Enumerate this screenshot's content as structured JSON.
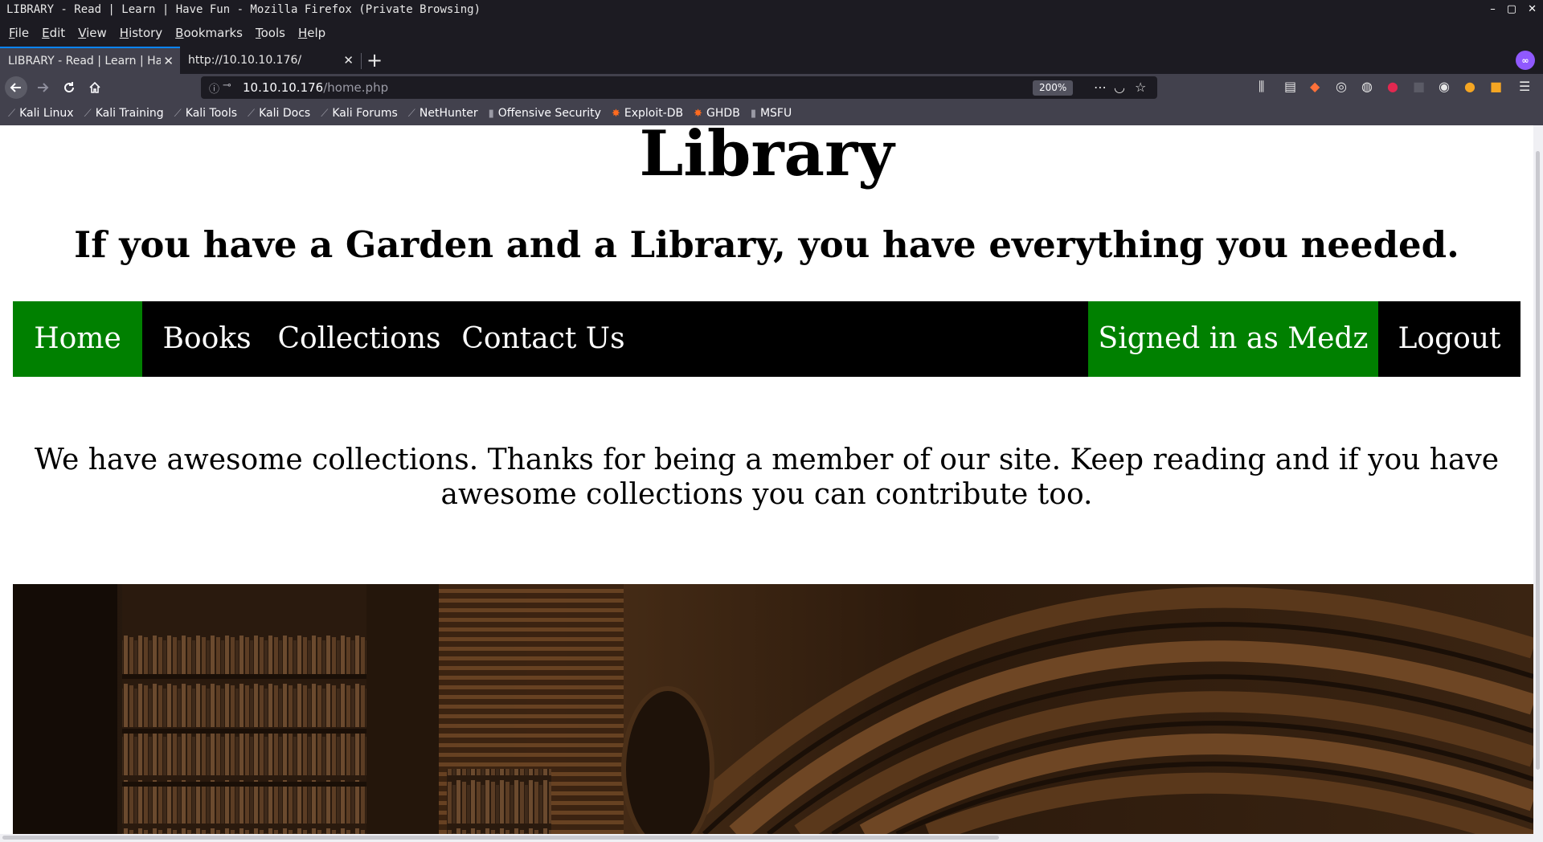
{
  "window": {
    "title": "LIBRARY - Read | Learn | Have Fun - Mozilla Firefox (Private Browsing)",
    "controls": [
      "–",
      "▢",
      "✕"
    ]
  },
  "menu": [
    "File",
    "Edit",
    "View",
    "History",
    "Bookmarks",
    "Tools",
    "Help"
  ],
  "tabs": [
    {
      "label": "LIBRARY - Read | Learn | Have Fun",
      "active": true
    },
    {
      "label": "http://10.10.10.176/",
      "active": false
    }
  ],
  "urlbar": {
    "host": "10.10.10.176",
    "path": "/home.php",
    "zoom": "200%"
  },
  "bookmarks": [
    {
      "label": "Kali Linux",
      "icon": "kali-dragon-icon"
    },
    {
      "label": "Kali Training",
      "icon": "kali-dragon-icon"
    },
    {
      "label": "Kali Tools",
      "icon": "kali-dragon-icon"
    },
    {
      "label": "Kali Docs",
      "icon": "kali-dragon-icon"
    },
    {
      "label": "Kali Forums",
      "icon": "kali-dragon-icon"
    },
    {
      "label": "NetHunter",
      "icon": "kali-dragon-icon"
    },
    {
      "label": "Offensive Security",
      "icon": "offsec-icon"
    },
    {
      "label": "Exploit-DB",
      "icon": "exploit-db-icon"
    },
    {
      "label": "GHDB",
      "icon": "exploit-db-icon"
    },
    {
      "label": "MSFU",
      "icon": "offsec-icon"
    }
  ],
  "page": {
    "title": "Library",
    "tagline": "If you have a Garden and a Library, you have everything you needed.",
    "nav": {
      "home": "Home",
      "books": "Books",
      "collections": "Collections",
      "contact": "Contact Us",
      "signed_in": "Signed in as Medz",
      "logout": "Logout"
    },
    "welcome": "We have awesome collections. Thanks for being a member of our site. Keep reading and if you have awesome collections you can contribute too."
  },
  "colors": {
    "nav_background": "#000000",
    "nav_active": "#008000",
    "page_background": "#ffffff",
    "chrome_dark": "#1c1b22",
    "chrome_toolbar": "#42414d"
  }
}
